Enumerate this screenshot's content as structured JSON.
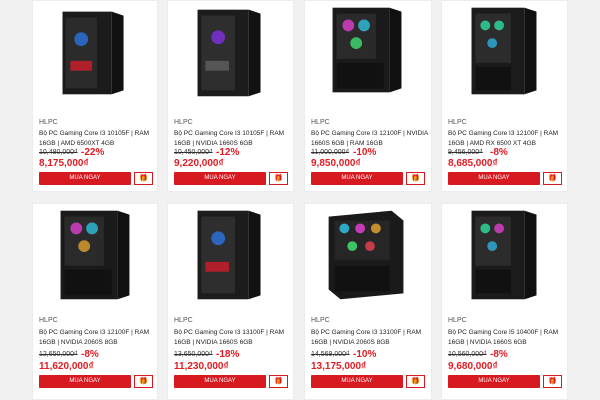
{
  "products": [
    {
      "brand": "HLPC",
      "name": "Bộ PC Gaming Core I3 10105F | RAM 16GB | AMD 6500XT 4GB",
      "old_price": "10,480,000₫",
      "discount": "-22%",
      "price": "8,175,000₫",
      "buy_label": "MUA NGAY",
      "gift_icon": "gift-icon",
      "case_style": "tower-dark"
    },
    {
      "brand": "HLPC",
      "name": "Bộ PC Gaming Core I3 10105F | RAM 16GB | NVIDIA 1660S 6GB",
      "old_price": "10,450,000₫",
      "discount": "-12%",
      "price": "9,220,000₫",
      "buy_label": "MUA NGAY",
      "gift_icon": "gift-icon",
      "case_style": "tower-dark"
    },
    {
      "brand": "HLPC",
      "name": "Bộ PC Gaming Core I3 12100F | NVIDIA 1660S 6GB | RAM 16GB",
      "old_price": "11,000,000₫",
      "discount": "-10%",
      "price": "9,850,000₫",
      "buy_label": "MUA NGAY",
      "gift_icon": "gift-icon",
      "case_style": "tower-rgb"
    },
    {
      "brand": "HLPC",
      "name": "Bộ PC Gaming Core I3 12100F | RAM 16GB | AMD RX 6500 XT 4GB",
      "old_price": "9,456,000₫",
      "discount": "-8%",
      "price": "8,685,000₫",
      "buy_label": "MUA NGAY",
      "gift_icon": "gift-icon",
      "case_style": "tower-rgb"
    },
    {
      "brand": "HLPC",
      "name": "Bộ PC Gaming Core I3 12100F | RAM 16GB | NVIDIA 2060S 8GB",
      "old_price": "12,650,000₫",
      "discount": "-8%",
      "price": "11,620,000₫",
      "buy_label": "MUA NGAY",
      "gift_icon": "gift-icon",
      "case_style": "tower-rgb"
    },
    {
      "brand": "HLPC",
      "name": "Bộ PC Gaming Core I3 13100F | RAM 16GB | NVIDIA 1660S 6GB",
      "old_price": "13,650,000₫",
      "discount": "-18%",
      "price": "11,230,000₫",
      "buy_label": "MUA NGAY",
      "gift_icon": "gift-icon",
      "case_style": "tower-dark"
    },
    {
      "brand": "HLPC",
      "name": "Bộ PC Gaming Core I3 13100F | RAM 16GB | NVIDIA 2060S 8GB",
      "old_price": "14,569,000₫",
      "discount": "-10%",
      "price": "13,175,000₫",
      "buy_label": "MUA NGAY",
      "gift_icon": "gift-icon",
      "case_style": "cube-rgb"
    },
    {
      "brand": "HLPC",
      "name": "Bộ PC Gaming Core I5 10400F | RAM 16GB | NVIDIA 1660S 6GB",
      "old_price": "10,560,000₫",
      "discount": "-8%",
      "price": "9,680,000₫",
      "buy_label": "MUA NGAY",
      "gift_icon": "gift-icon",
      "case_style": "tower-rgb"
    }
  ],
  "colors": {
    "accent": "#d71920",
    "price": "#e31b23",
    "background": "#f1f1f1"
  }
}
